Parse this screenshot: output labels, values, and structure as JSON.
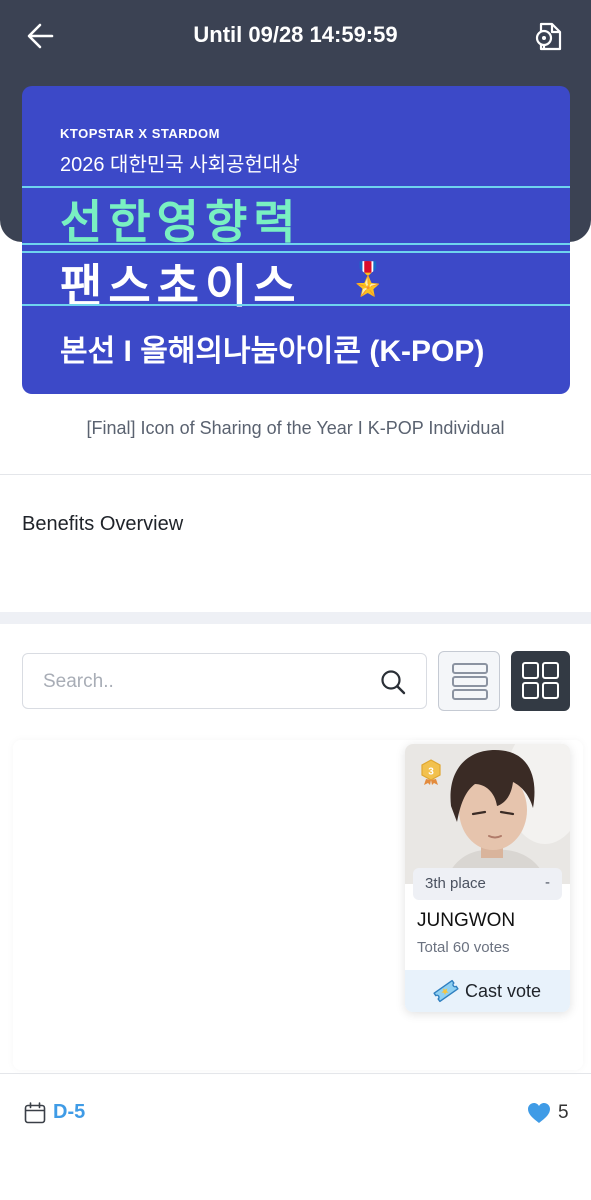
{
  "header": {
    "title": "Until 09/28 14:59:59",
    "back_icon": "back-arrow-icon",
    "share_icon": "share-document-icon"
  },
  "banner": {
    "brand": "KTOPSTAR X STARDOM",
    "subtitle": "2026 대한민국 사회공헌대상",
    "headline_1": "선한영향력",
    "headline_2": "팬스초이스",
    "tagline": "본선 I 올해의나눔아이콘 (K-POP)",
    "accent_color": "#79f0c2",
    "background_color": "#3c49c8"
  },
  "event": {
    "caption": "[Final] Icon of Sharing of the Year I K-POP Individual"
  },
  "benefits": {
    "title": "Benefits Overview"
  },
  "search": {
    "placeholder": "Search.."
  },
  "view_toggle": {
    "options": [
      "list",
      "grid"
    ],
    "selected": "grid"
  },
  "candidates": [
    {
      "name": "JUNGWON",
      "rank_badge": "3",
      "place_label": "3th place",
      "rank_change": "-",
      "votes_label": "Total 60 votes",
      "vote_button_label": "Cast vote",
      "vote_icon": "ticket-icon"
    }
  ],
  "footer": {
    "dday": "D-5",
    "likes": "5",
    "calendar_icon": "calendar-icon",
    "heart_icon": "heart-icon",
    "dday_color": "#3f9be6"
  }
}
